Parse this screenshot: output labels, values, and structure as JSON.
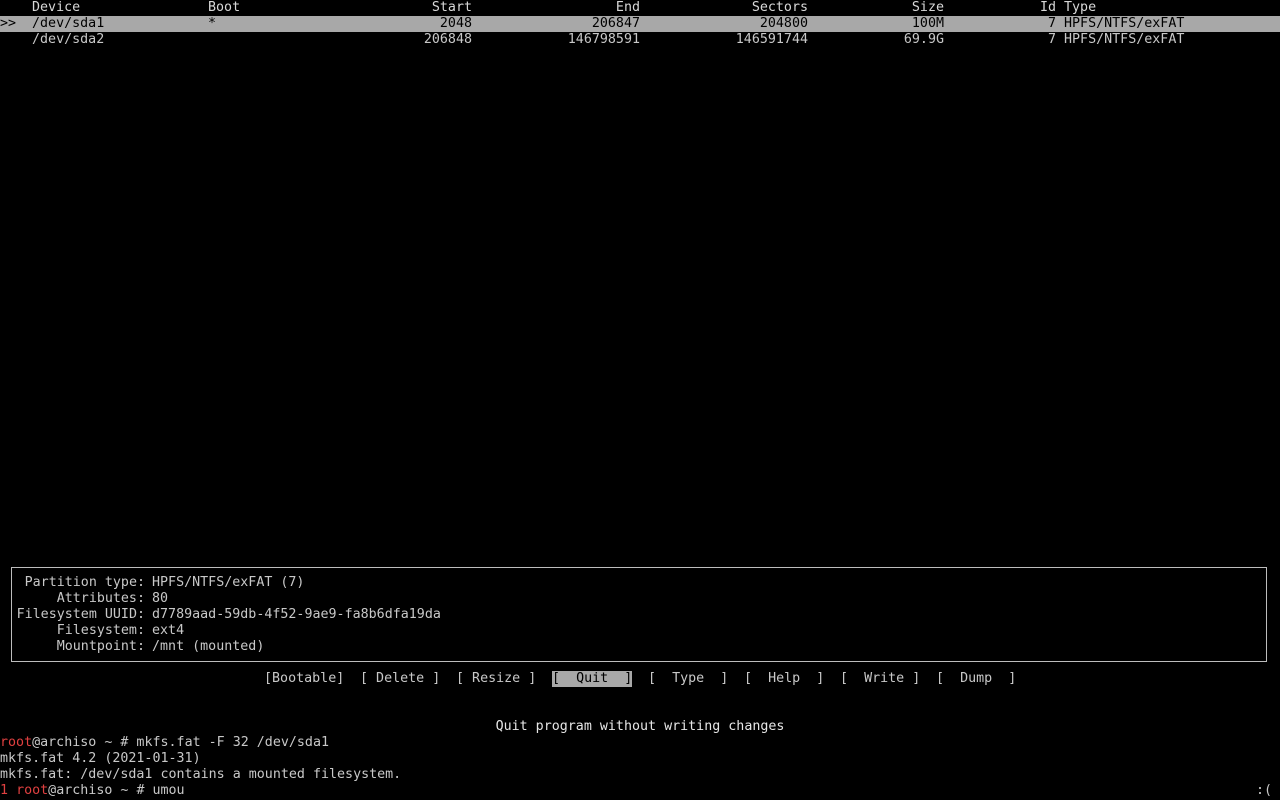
{
  "table": {
    "headers": {
      "device": "Device",
      "boot": "Boot",
      "start": "Start",
      "end": "End",
      "sectors": "Sectors",
      "size": "Size",
      "id": "Id",
      "type": "Type"
    },
    "rows": [
      {
        "marker": ">>",
        "device": "/dev/sda1",
        "boot": "*",
        "start": "2048",
        "end": "206847",
        "sectors": "204800",
        "size": "100M",
        "id": "7",
        "type": "HPFS/NTFS/exFAT"
      },
      {
        "marker": "",
        "device": "/dev/sda2",
        "boot": "",
        "start": "206848",
        "end": "146798591",
        "sectors": "146591744",
        "size": "69.9G",
        "id": "7",
        "type": "HPFS/NTFS/exFAT"
      }
    ]
  },
  "info": {
    "rows": [
      {
        "label": "Partition type:",
        "value": "HPFS/NTFS/exFAT (7)"
      },
      {
        "label": "Attributes:",
        "value": "80"
      },
      {
        "label": "Filesystem UUID:",
        "value": "d7789aad-59db-4f52-9ae9-fa8b6dfa19da"
      },
      {
        "label": "Filesystem:",
        "value": "ext4"
      },
      {
        "label": "Mountpoint:",
        "value": "/mnt (mounted)"
      }
    ]
  },
  "menu": {
    "buttons": [
      {
        "label": "[Bootable]"
      },
      {
        "label": "[ Delete ]"
      },
      {
        "label": "[ Resize ]"
      },
      {
        "label": "[  Quit  ]",
        "selected": true
      },
      {
        "label": "[  Type  ]"
      },
      {
        "label": "[  Help  ]"
      },
      {
        "label": "[  Write ]"
      },
      {
        "label": "[  Dump  ]"
      }
    ],
    "hint": "Quit program without writing changes"
  },
  "shell": {
    "line1": {
      "user": "root",
      "rest": "@archiso ~ # mkfs.fat -F 32 /dev/sda1"
    },
    "line2": "mkfs.fat 4.2 (2021-01-31)",
    "line3": "mkfs.fat: /dev/sda1 contains a mounted filesystem.",
    "line4": {
      "code": "1",
      "user": "root",
      "rest": "@archiso ~ # umou"
    },
    "status": ":("
  }
}
